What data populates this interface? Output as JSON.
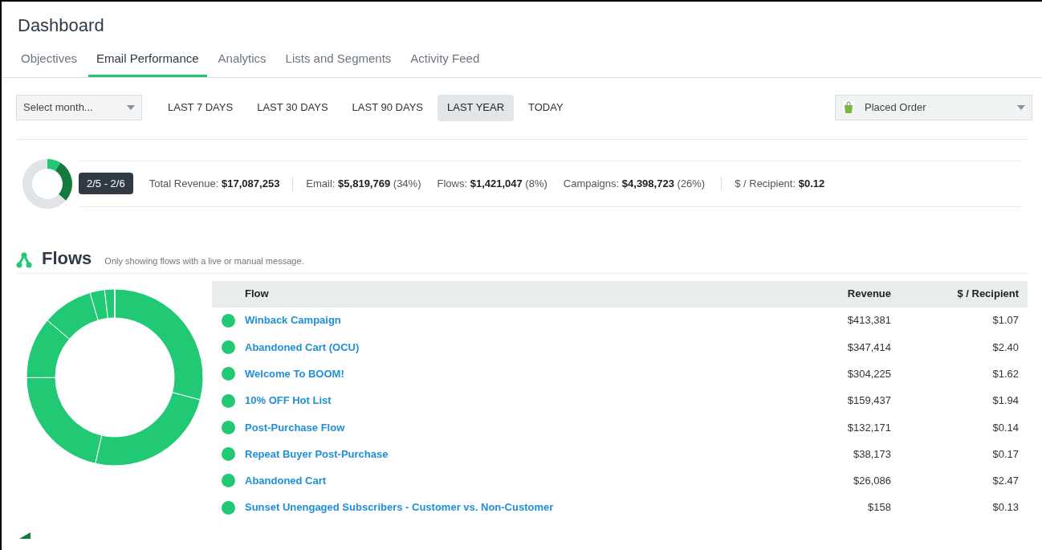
{
  "page": {
    "title": "Dashboard"
  },
  "tabs": [
    {
      "label": "Objectives",
      "selected": false
    },
    {
      "label": "Email Performance",
      "selected": true
    },
    {
      "label": "Analytics",
      "selected": false
    },
    {
      "label": "Lists and Segments",
      "selected": false
    },
    {
      "label": "Activity Feed",
      "selected": false
    }
  ],
  "filters": {
    "month_select": {
      "placeholder": "Select month..."
    },
    "ranges": [
      {
        "label": "LAST 7 DAYS",
        "selected": false
      },
      {
        "label": "LAST 30 DAYS",
        "selected": false
      },
      {
        "label": "LAST 90 DAYS",
        "selected": false
      },
      {
        "label": "LAST YEAR",
        "selected": true
      },
      {
        "label": "TODAY",
        "selected": false
      }
    ],
    "metric_select": {
      "value": "Placed Order"
    }
  },
  "summary": {
    "date_range": "2/5 - 2/6",
    "metrics": [
      {
        "label": "Total Revenue:",
        "value": "$17,087,253"
      },
      {
        "label": "Email:",
        "value": "$5,819,769",
        "share": "(34%)"
      },
      {
        "label": "Flows:",
        "value": "$1,421,047",
        "share": "(8%)"
      },
      {
        "label": "Campaigns:",
        "value": "$4,398,723",
        "share": "(26%)"
      },
      {
        "label": "$ / Recipient:",
        "value": "$0.12"
      }
    ]
  },
  "flows": {
    "title": "Flows",
    "note": "Only showing flows with a live or manual message.",
    "columns": [
      "Flow",
      "Revenue",
      "$ / Recipient"
    ],
    "rows": [
      {
        "name": "Winback Campaign",
        "revenue": "$413,381",
        "per_recipient": "$1.07",
        "color": "#22c974"
      },
      {
        "name": "Abandoned Cart (OCU)",
        "revenue": "$347,414",
        "per_recipient": "$2.40",
        "color": "#22c974"
      },
      {
        "name": "Welcome To BOOM!",
        "revenue": "$304,225",
        "per_recipient": "$1.62",
        "color": "#22c974"
      },
      {
        "name": "10% OFF Hot List",
        "revenue": "$159,437",
        "per_recipient": "$1.94",
        "color": "#22c974"
      },
      {
        "name": "Post-Purchase Flow",
        "revenue": "$132,171",
        "per_recipient": "$0.14",
        "color": "#22c974"
      },
      {
        "name": "Repeat Buyer Post-Purchase",
        "revenue": "$38,173",
        "per_recipient": "$0.17",
        "color": "#22c974"
      },
      {
        "name": "Abandoned Cart",
        "revenue": "$26,086",
        "per_recipient": "$2.47",
        "color": "#22c974"
      },
      {
        "name": "Sunset Unengaged Subscribers - Customer vs. Non-Customer",
        "revenue": "$158",
        "per_recipient": "$0.13",
        "color": "#22c974"
      }
    ]
  }
}
